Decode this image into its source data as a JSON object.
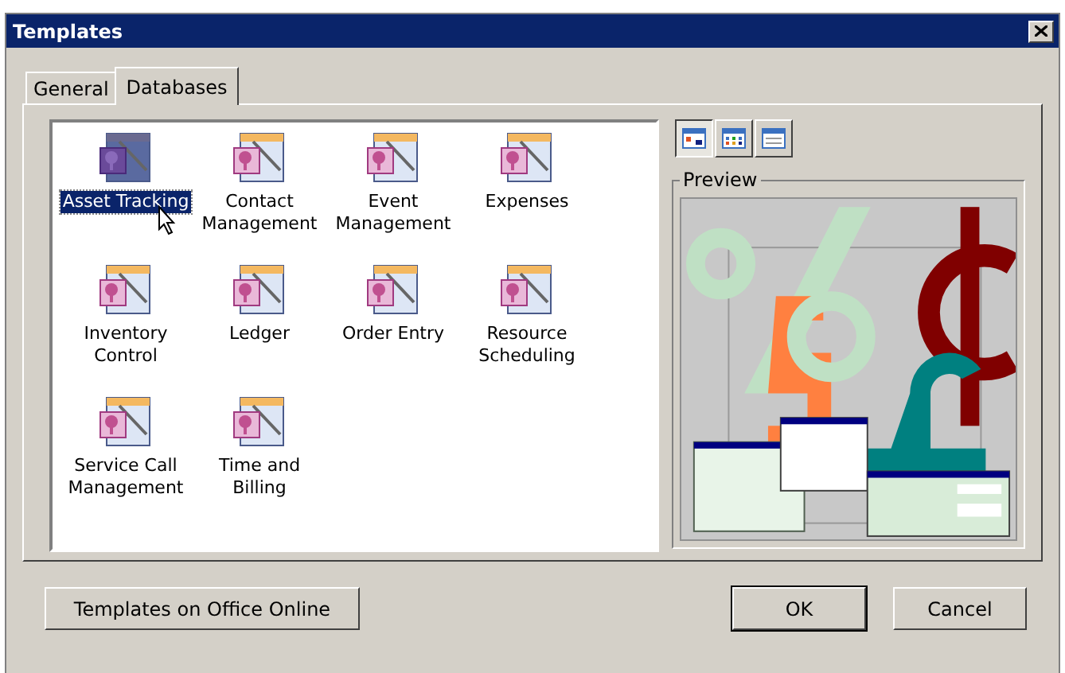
{
  "window": {
    "title": "Templates"
  },
  "tabs": [
    {
      "label": "General",
      "selected": false
    },
    {
      "label": "Databases",
      "selected": true
    }
  ],
  "templates": [
    {
      "label": "Asset Tracking",
      "selected": true
    },
    {
      "label": "Contact Management",
      "selected": false
    },
    {
      "label": "Event Management",
      "selected": false
    },
    {
      "label": "Expenses",
      "selected": false
    },
    {
      "label": "Inventory Control",
      "selected": false
    },
    {
      "label": "Ledger",
      "selected": false
    },
    {
      "label": "Order Entry",
      "selected": false
    },
    {
      "label": "Resource Scheduling",
      "selected": false
    },
    {
      "label": "Service Call Management",
      "selected": false
    },
    {
      "label": "Time and Billing",
      "selected": false
    }
  ],
  "view_buttons": [
    {
      "kind": "large-icons",
      "selected": true
    },
    {
      "kind": "list",
      "selected": false
    },
    {
      "kind": "details",
      "selected": false
    }
  ],
  "preview": {
    "label": "Preview"
  },
  "buttons": [
    {
      "label": "Templates on Office Online",
      "kind": "normal"
    },
    {
      "label": "OK",
      "kind": "default"
    },
    {
      "label": "Cancel",
      "kind": "normal"
    }
  ]
}
